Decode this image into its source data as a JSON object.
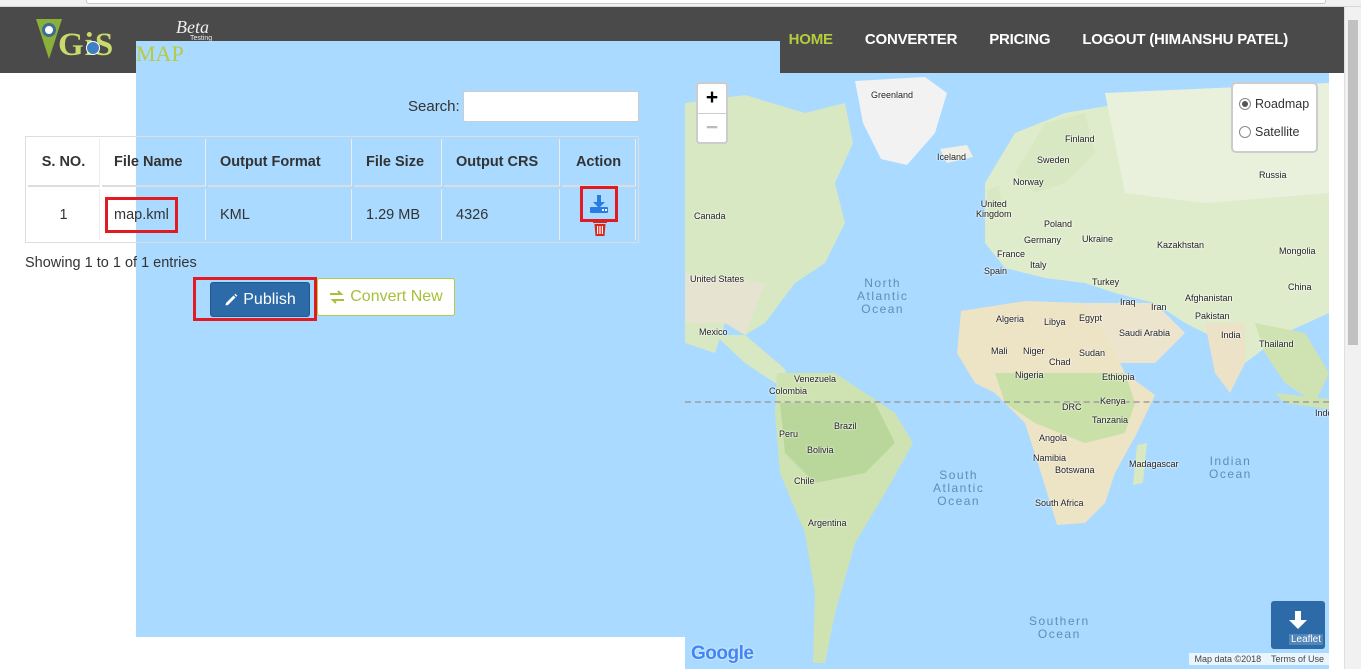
{
  "header": {
    "logo": {
      "word": "GiS",
      "map": "MAP",
      "beta": "Beta",
      "testing": "Testing"
    },
    "nav": [
      {
        "label": "HOME",
        "active": true
      },
      {
        "label": "CONVERTER",
        "active": false
      },
      {
        "label": "PRICING",
        "active": false
      },
      {
        "label": "LOGOUT (HIMANSHU PATEL)",
        "active": false
      }
    ]
  },
  "search": {
    "label": "Search:",
    "value": ""
  },
  "table": {
    "headers": [
      "S. NO.",
      "File Name",
      "Output Format",
      "File Size",
      "Output CRS",
      "Action"
    ],
    "rows": [
      {
        "sno": "1",
        "file_name": "map.kml",
        "format": "KML",
        "size": "1.29 MB",
        "crs": "4326"
      }
    ]
  },
  "showing": "Showing 1 to 1 of 1 entries",
  "buttons": {
    "publish": "Publish",
    "convert_new": "Convert New"
  },
  "map": {
    "zoom_in": "+",
    "zoom_out": "−",
    "layers": [
      {
        "label": "Roadmap",
        "selected": true
      },
      {
        "label": "Satellite",
        "selected": false
      }
    ],
    "oceans": {
      "north_atlantic": "North\nAtlantic\nOcean",
      "south_atlantic": "South\nAtlantic\nOcean",
      "indian": "Indian\nOcean",
      "southern": "Southern\nOcean"
    },
    "places": {
      "greenland": "Greenland",
      "iceland": "Iceland",
      "finland": "Finland",
      "sweden": "Sweden",
      "norway": "Norway",
      "russia": "Russia",
      "canada": "Canada",
      "uk": "United\nKingdom",
      "poland": "Poland",
      "germany": "Germany",
      "ukraine": "Ukraine",
      "kazakhstan": "Kazakhstan",
      "mongolia": "Mongolia",
      "france": "France",
      "spain": "Spain",
      "italy": "Italy",
      "usa": "United States",
      "turkey": "Turkey",
      "china": "China",
      "iraq": "Iraq",
      "iran": "Iran",
      "afghanistan": "Afghanistan",
      "pakistan": "Pakistan",
      "mexico": "Mexico",
      "algeria": "Algeria",
      "libya": "Libya",
      "egypt": "Egypt",
      "saudi": "Saudi Arabia",
      "india": "India",
      "mali": "Mali",
      "niger": "Niger",
      "chad": "Chad",
      "sudan": "Sudan",
      "thailand": "Thailand",
      "venezuela": "Venezuela",
      "colombia": "Colombia",
      "nigeria": "Nigeria",
      "ethiopia": "Ethiopia",
      "kenya": "Kenya",
      "drc": "DRC",
      "tanzania": "Tanzania",
      "indo": "Indo",
      "peru": "Peru",
      "brazil": "Brazil",
      "bolivia": "Bolivia",
      "angola": "Angola",
      "namibia": "Namibia",
      "botswana": "Botswana",
      "madagascar": "Madagascar",
      "chile": "Chile",
      "south_africa": "South Africa",
      "argentina": "Argentina"
    },
    "google": "Google",
    "map_data": "Map data ©2018",
    "terms": "Terms of Use",
    "leaflet": "Leaflet"
  },
  "colors": {
    "header_bg": "#4a4a4a",
    "accent": "#b5cc3d",
    "primary": "#2c6aa8",
    "highlight": "#e01b24"
  }
}
